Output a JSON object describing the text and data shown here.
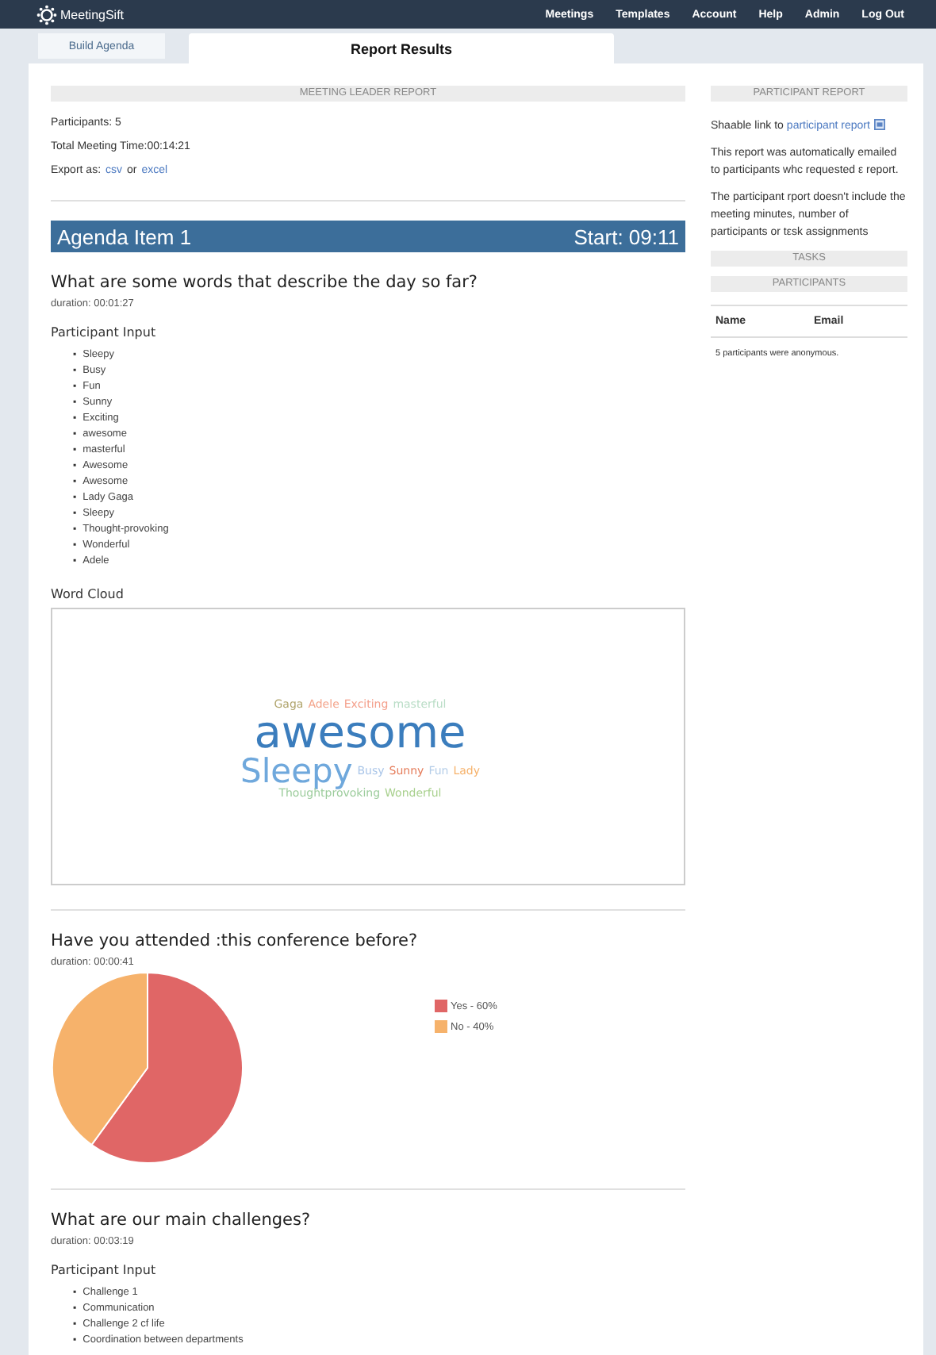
{
  "nav": {
    "brand": "MeetingSift",
    "links": [
      "Meetings",
      "Templates",
      "Account",
      "Help",
      "Admin",
      "Log Out"
    ]
  },
  "tabs": [
    {
      "label": "Build Agenda",
      "selected": false
    },
    {
      "label": "Report Results",
      "selected": true
    }
  ],
  "leader_report": {
    "heading": "MEETING LEADER REPORT",
    "participants": "Participants: 5",
    "total_time": "Total Meeting Time:00:14:21",
    "export_label": "Export as:",
    "export_links": [
      "csv",
      "excel"
    ],
    "export_joiner": "or"
  },
  "agenda_items": [
    {
      "title": "Agenda Item 1",
      "start": "Start: 09:11",
      "questions": [
        {
          "title": "What are some words that describe the day so far?",
          "duration": "duration: 00:01:27",
          "participant_input": {
            "heading": "Participant Input",
            "bullet": "▪",
            "items": [
              "Sleepy",
              "Busy",
              "Fun",
              "Sunny",
              "Exciting",
              "awesome",
              "masterful",
              "Awesome",
              "Awesome",
              "Lady Gaga",
              "Sleepy",
              "Thought-provoking",
              "Wonderful",
              "Adele"
            ]
          },
          "word_cloud": {
            "heading": "Word Cloud",
            "lines": [
              {
                "words": [
                  {
                    "text": "Gaga",
                    "kind": "small",
                    "color": "#b0a46c"
                  },
                  {
                    "text": "Adele",
                    "kind": "small",
                    "color": "#f4a58c"
                  },
                  {
                    "text": "Exciting",
                    "kind": "small",
                    "color": "#f4a08c"
                  },
                  {
                    "text": "masterful",
                    "kind": "small",
                    "color": "#b9ddc6"
                  }
                ]
              },
              {
                "words": [
                  {
                    "text": "awesome",
                    "kind": "large",
                    "color": "#3b7dbd"
                  }
                ]
              },
              {
                "words": [
                  {
                    "text": "Sleepy",
                    "kind": "medium",
                    "color": "#6fa8dc"
                  },
                  {
                    "text": "Busy",
                    "kind": "small",
                    "color": "#a9c5e8"
                  },
                  {
                    "text": "Sunny",
                    "kind": "small",
                    "color": "#e57c5a"
                  },
                  {
                    "text": "Fun",
                    "kind": "small",
                    "color": "#b4cde8"
                  },
                  {
                    "text": "Lady",
                    "kind": "small",
                    "color": "#f6b26b"
                  }
                ]
              },
              {
                "words": [
                  {
                    "text": "Thoughtprovoking",
                    "kind": "small",
                    "color": "#9ccc9c"
                  },
                  {
                    "text": "Wonderful",
                    "kind": "small",
                    "color": "#a8d08d"
                  }
                ]
              }
            ]
          }
        },
        {
          "title": "Have you attended :this conference before?",
          "duration": "duration: 00:00:41",
          "chart": {
            "chart_data": {
              "type": "pie",
              "categories": [
                "Yes - 60%",
                "No - 40%"
              ],
              "values": [
                60,
                40
              ],
              "colors": [
                "#e06666",
                "#f6b26b"
              ],
              "legend": "right"
            }
          }
        },
        {
          "title": "What are our main challenges?",
          "duration": "duration: 00:03:19",
          "participant_input": {
            "heading": "Participant Input",
            "bullet": "▪",
            "items": [
              "Challenge 1",
              "Communication",
              "Challenge 2 cf life",
              "Coordination between departments"
            ]
          }
        }
      ]
    }
  ],
  "participant_report": {
    "heading": "PARTICIPANT REPORT",
    "link_prefix": "Shaable link to",
    "link": "participant report",
    "paragraphs": [
      "This report was automatically emailed to participants whc requested ε report.",
      "The participant rport doesn't include the meeting minutes, number of participants or tεsk assignments"
    ]
  },
  "tasks": {
    "heading": "TASKS"
  },
  "participants": {
    "heading": "PARTICIPANTS",
    "columns": [
      "Name",
      "Email"
    ],
    "note": "5 participants were anonymous."
  }
}
